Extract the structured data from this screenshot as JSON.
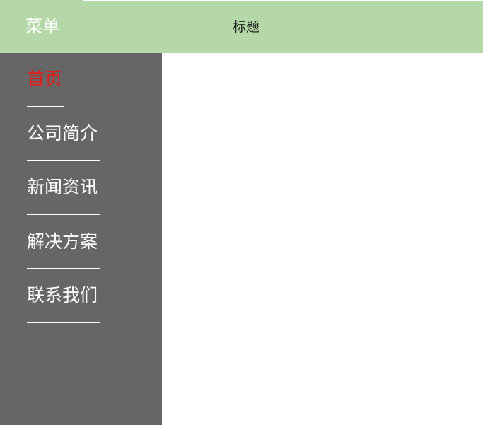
{
  "header": {
    "menu_label": "菜单",
    "title": "标题"
  },
  "sidebar": {
    "items": [
      {
        "label": "首页",
        "active": true
      },
      {
        "label": "公司简介",
        "active": false
      },
      {
        "label": "新闻资讯",
        "active": false
      },
      {
        "label": "解决方案",
        "active": false
      },
      {
        "label": "联系我们",
        "active": false
      }
    ]
  },
  "colors": {
    "header_bg": "#b5d8a8",
    "sidebar_bg": "#666666",
    "active_text": "#e41b1b",
    "nav_text": "#ffffff"
  }
}
